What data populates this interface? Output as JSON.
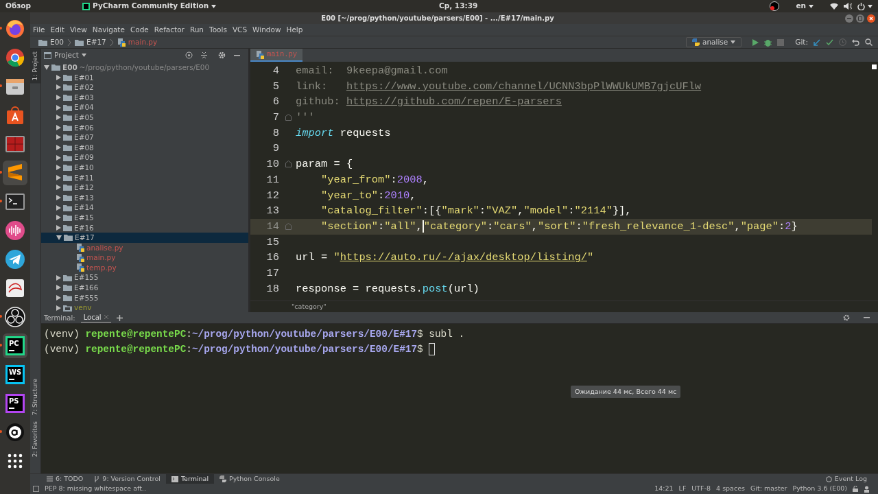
{
  "top_bar": {
    "activities": "Обзор",
    "app_menu": "PyCharm Community Edition",
    "clock": "Ср, 13:39",
    "language": "en"
  },
  "dock": [
    {
      "kind": "firefox",
      "running": true,
      "selected": false
    },
    {
      "kind": "chrome",
      "running": false,
      "selected": false
    },
    {
      "kind": "files",
      "running": true,
      "selected": false
    },
    {
      "kind": "software",
      "running": false,
      "selected": false
    },
    {
      "kind": "monitor",
      "running": false,
      "selected": false
    },
    {
      "kind": "sublime",
      "running": true,
      "selected": true
    },
    {
      "kind": "terminal",
      "running": true,
      "selected": false
    },
    {
      "kind": "audio",
      "running": false,
      "selected": false
    },
    {
      "kind": "telegram",
      "running": false,
      "selected": false
    },
    {
      "kind": "reader",
      "running": false,
      "selected": false
    },
    {
      "kind": "obs",
      "running": true,
      "selected": false
    },
    {
      "kind": "jetbrains",
      "label": "PC",
      "color": "#21d789",
      "running": true,
      "selected": true
    },
    {
      "kind": "jetbrains",
      "label": "WS",
      "color": "#07c3f2",
      "running": false,
      "selected": false
    },
    {
      "kind": "jetbrains",
      "label": "PS",
      "color": "#b345f1",
      "running": false,
      "selected": false
    },
    {
      "kind": "circle_a",
      "running": true,
      "selected": false
    },
    {
      "kind": "apps",
      "running": false,
      "selected": false
    }
  ],
  "window": {
    "title": "E00 [~/prog/python/youtube/parsers/E00] - .../E#17/main.py"
  },
  "menu": [
    "File",
    "Edit",
    "View",
    "Navigate",
    "Code",
    "Refactor",
    "Run",
    "Tools",
    "VCS",
    "Window",
    "Help"
  ],
  "breadcrumbs": [
    {
      "kind": "folder",
      "label": "E00"
    },
    {
      "kind": "folder",
      "label": "E#17"
    },
    {
      "kind": "python_file",
      "label": "main.py"
    }
  ],
  "toolbar": {
    "run_config": "analise",
    "vcs_label": "Git:"
  },
  "left_strip": {
    "top": [
      {
        "label": "1: Project",
        "selected": true
      }
    ],
    "bottom": [
      {
        "label": "7: Structure",
        "selected": false
      },
      {
        "label": "2: Favorites",
        "selected": false
      }
    ]
  },
  "project": {
    "title": "Project",
    "tree": [
      {
        "kind": "folder",
        "label": "E00",
        "path": "~/prog/python/youtube/parsers/E00",
        "expanded": true,
        "selected": false,
        "children": [
          {
            "kind": "folder",
            "label": "E#01",
            "expanded": false,
            "selected": false
          },
          {
            "kind": "folder",
            "label": "E#02",
            "expanded": false,
            "selected": false
          },
          {
            "kind": "folder",
            "label": "E#03",
            "expanded": false,
            "selected": false
          },
          {
            "kind": "folder",
            "label": "E#04",
            "expanded": false,
            "selected": false
          },
          {
            "kind": "folder",
            "label": "E#05",
            "expanded": false,
            "selected": false
          },
          {
            "kind": "folder",
            "label": "E#06",
            "expanded": false,
            "selected": false
          },
          {
            "kind": "folder",
            "label": "E#07",
            "expanded": false,
            "selected": false
          },
          {
            "kind": "folder",
            "label": "E#08",
            "expanded": false,
            "selected": false
          },
          {
            "kind": "folder",
            "label": "E#09",
            "expanded": false,
            "selected": false
          },
          {
            "kind": "folder",
            "label": "E#10",
            "expanded": false,
            "selected": false
          },
          {
            "kind": "folder",
            "label": "E#11",
            "expanded": false,
            "selected": false
          },
          {
            "kind": "folder",
            "label": "E#12",
            "expanded": false,
            "selected": false
          },
          {
            "kind": "folder",
            "label": "E#13",
            "expanded": false,
            "selected": false
          },
          {
            "kind": "folder",
            "label": "E#14",
            "expanded": false,
            "selected": false
          },
          {
            "kind": "folder",
            "label": "E#15",
            "expanded": false,
            "selected": false
          },
          {
            "kind": "folder",
            "label": "E#16",
            "expanded": false,
            "selected": false
          },
          {
            "kind": "folder",
            "label": "E#17",
            "expanded": true,
            "selected": true,
            "children": [
              {
                "kind": "python_file",
                "label": "analise.py",
                "color": "#c75450",
                "selected": false
              },
              {
                "kind": "python_file",
                "label": "main.py",
                "color": "#c75450",
                "selected": false
              },
              {
                "kind": "python_file",
                "label": "temp.py",
                "color": "#c75450",
                "selected": false
              }
            ]
          },
          {
            "kind": "folder",
            "label": "E#155",
            "expanded": false,
            "selected": false
          },
          {
            "kind": "folder",
            "label": "E#166",
            "expanded": false,
            "selected": false
          },
          {
            "kind": "folder",
            "label": "E#555",
            "expanded": false,
            "selected": false
          },
          {
            "kind": "excluded_folder",
            "label": "venv",
            "color": "#9a9a30",
            "expanded": false,
            "selected": false
          }
        ]
      }
    ]
  },
  "editor": {
    "tabs": [
      {
        "label": "main.py",
        "selected": true
      }
    ],
    "lines": [
      {
        "number": "4",
        "current": false,
        "fold": false,
        "tokens": [
          {
            "kind": "doc",
            "text": "email:  9keepa@gmail.com"
          }
        ]
      },
      {
        "number": "5",
        "current": false,
        "fold": false,
        "tokens": [
          {
            "kind": "doc",
            "text": "link:   "
          },
          {
            "kind": "doclink",
            "text": "https://www.youtube.com/channel/UCNN3bpPlWWUkUMB7gjcUFlw"
          }
        ]
      },
      {
        "number": "6",
        "current": false,
        "fold": false,
        "tokens": [
          {
            "kind": "doc",
            "text": "github: "
          },
          {
            "kind": "doclink",
            "text": "https://github.com/repen/E-parsers"
          }
        ]
      },
      {
        "number": "7",
        "current": false,
        "fold": true,
        "tokens": [
          {
            "kind": "doc",
            "text": "'''"
          }
        ]
      },
      {
        "number": "8",
        "current": false,
        "fold": false,
        "tokens": [
          {
            "kind": "keyword",
            "text": "import"
          },
          {
            "kind": "plain",
            "text": " requests"
          }
        ]
      },
      {
        "number": "9",
        "current": false,
        "fold": false
      },
      {
        "number": "10",
        "current": false,
        "fold": true,
        "tokens": [
          {
            "kind": "plain",
            "text": "param = {"
          }
        ]
      },
      {
        "number": "11",
        "current": false,
        "fold": false,
        "indented": true,
        "tokens": [
          {
            "kind": "string",
            "text": "\"year_from\""
          },
          {
            "kind": "plain",
            "text": ":"
          },
          {
            "kind": "number",
            "text": "2008"
          },
          {
            "kind": "plain",
            "text": ","
          }
        ]
      },
      {
        "number": "12",
        "current": false,
        "fold": false,
        "indented": true,
        "tokens": [
          {
            "kind": "string",
            "text": "\"year_to\""
          },
          {
            "kind": "plain",
            "text": ":"
          },
          {
            "kind": "number",
            "text": "2010"
          },
          {
            "kind": "plain",
            "text": ","
          }
        ]
      },
      {
        "number": "13",
        "current": false,
        "fold": false,
        "indented": true,
        "tokens": [
          {
            "kind": "string",
            "text": "\"catalog_filter\""
          },
          {
            "kind": "plain",
            "text": ":[{"
          },
          {
            "kind": "string",
            "text": "\"mark\""
          },
          {
            "kind": "plain",
            "text": ":"
          },
          {
            "kind": "string",
            "text": "\"VAZ\""
          },
          {
            "kind": "plain",
            "text": ","
          },
          {
            "kind": "string",
            "text": "\"model\""
          },
          {
            "kind": "plain",
            "text": ":"
          },
          {
            "kind": "string",
            "text": "\"2114\""
          },
          {
            "kind": "plain",
            "text": "}],"
          }
        ]
      },
      {
        "number": "14",
        "current": true,
        "fold": true,
        "indented": true,
        "tokens": [
          {
            "kind": "string",
            "text": "\"section\""
          },
          {
            "kind": "plain",
            "text": ":"
          },
          {
            "kind": "string",
            "text": "\"all\""
          },
          {
            "kind": "plain",
            "text": ","
          },
          {
            "kind": "caret"
          },
          {
            "kind": "string",
            "text": "\"category\""
          },
          {
            "kind": "plain",
            "text": ":"
          },
          {
            "kind": "string",
            "text": "\"cars\""
          },
          {
            "kind": "plain",
            "text": ","
          },
          {
            "kind": "string",
            "text": "\"sort\""
          },
          {
            "kind": "plain",
            "text": ":"
          },
          {
            "kind": "string",
            "text": "\"fresh_relevance_1-desc\""
          },
          {
            "kind": "plain",
            "text": ","
          },
          {
            "kind": "string",
            "text": "\"page\""
          },
          {
            "kind": "plain",
            "text": ":"
          },
          {
            "kind": "number",
            "text": "2"
          },
          {
            "kind": "plain",
            "text": "}"
          }
        ]
      },
      {
        "number": "15",
        "current": false,
        "fold": false
      },
      {
        "number": "16",
        "current": false,
        "fold": false,
        "tokens": [
          {
            "kind": "plain",
            "text": "url = "
          },
          {
            "kind": "string",
            "text": "\""
          },
          {
            "kind": "stringlink",
            "text": "https://auto.ru/-/ajax/desktop/listing/"
          },
          {
            "kind": "string",
            "text": "\""
          }
        ]
      },
      {
        "number": "17",
        "current": false,
        "fold": false
      },
      {
        "number": "18",
        "current": false,
        "fold": false,
        "tokens": [
          {
            "kind": "plain",
            "text": "response = requests."
          },
          {
            "kind": "func",
            "text": "post"
          },
          {
            "kind": "plain",
            "text": "(url)"
          }
        ]
      }
    ],
    "breadcrumb": "\"category\""
  },
  "terminal": {
    "title": "Terminal:",
    "tabs": [
      {
        "label": "Local",
        "selected": true
      }
    ],
    "lines": [
      {
        "tokens": [
          {
            "kind": "plain",
            "text": "(venv) "
          },
          {
            "kind": "user",
            "text": "repente@repentePC"
          },
          {
            "kind": "plain",
            "text": ":"
          },
          {
            "kind": "path",
            "text": "~/prog/python/youtube/parsers/E00/E#17"
          },
          {
            "kind": "plain",
            "text": "$ subl ."
          }
        ]
      },
      {
        "tokens": [
          {
            "kind": "plain",
            "text": "(venv) "
          },
          {
            "kind": "user",
            "text": "repente@repentePC"
          },
          {
            "kind": "plain",
            "text": ":"
          },
          {
            "kind": "path",
            "text": "~/prog/python/youtube/parsers/E00/E#17"
          },
          {
            "kind": "plain",
            "text": "$ "
          },
          {
            "kind": "cursor"
          }
        ]
      }
    ]
  },
  "tooltip": "Ожидание 44 мс, Всего 44 мс",
  "tool_windows": [
    {
      "kind": "todo",
      "label": "6: TODO",
      "selected": false
    },
    {
      "kind": "vcs",
      "label": "9: Version Control",
      "selected": false
    },
    {
      "kind": "terminal",
      "label": "Terminal",
      "selected": true
    },
    {
      "kind": "console",
      "label": "Python Console",
      "selected": false
    }
  ],
  "event_log": "Event Log",
  "status_bar": {
    "message": "PEP 8: missing whitespace aft..",
    "items": [
      "14:21",
      "LF",
      "UTF-8",
      "4 spaces",
      "Git: master",
      "Python 3.6 (E00)"
    ]
  }
}
